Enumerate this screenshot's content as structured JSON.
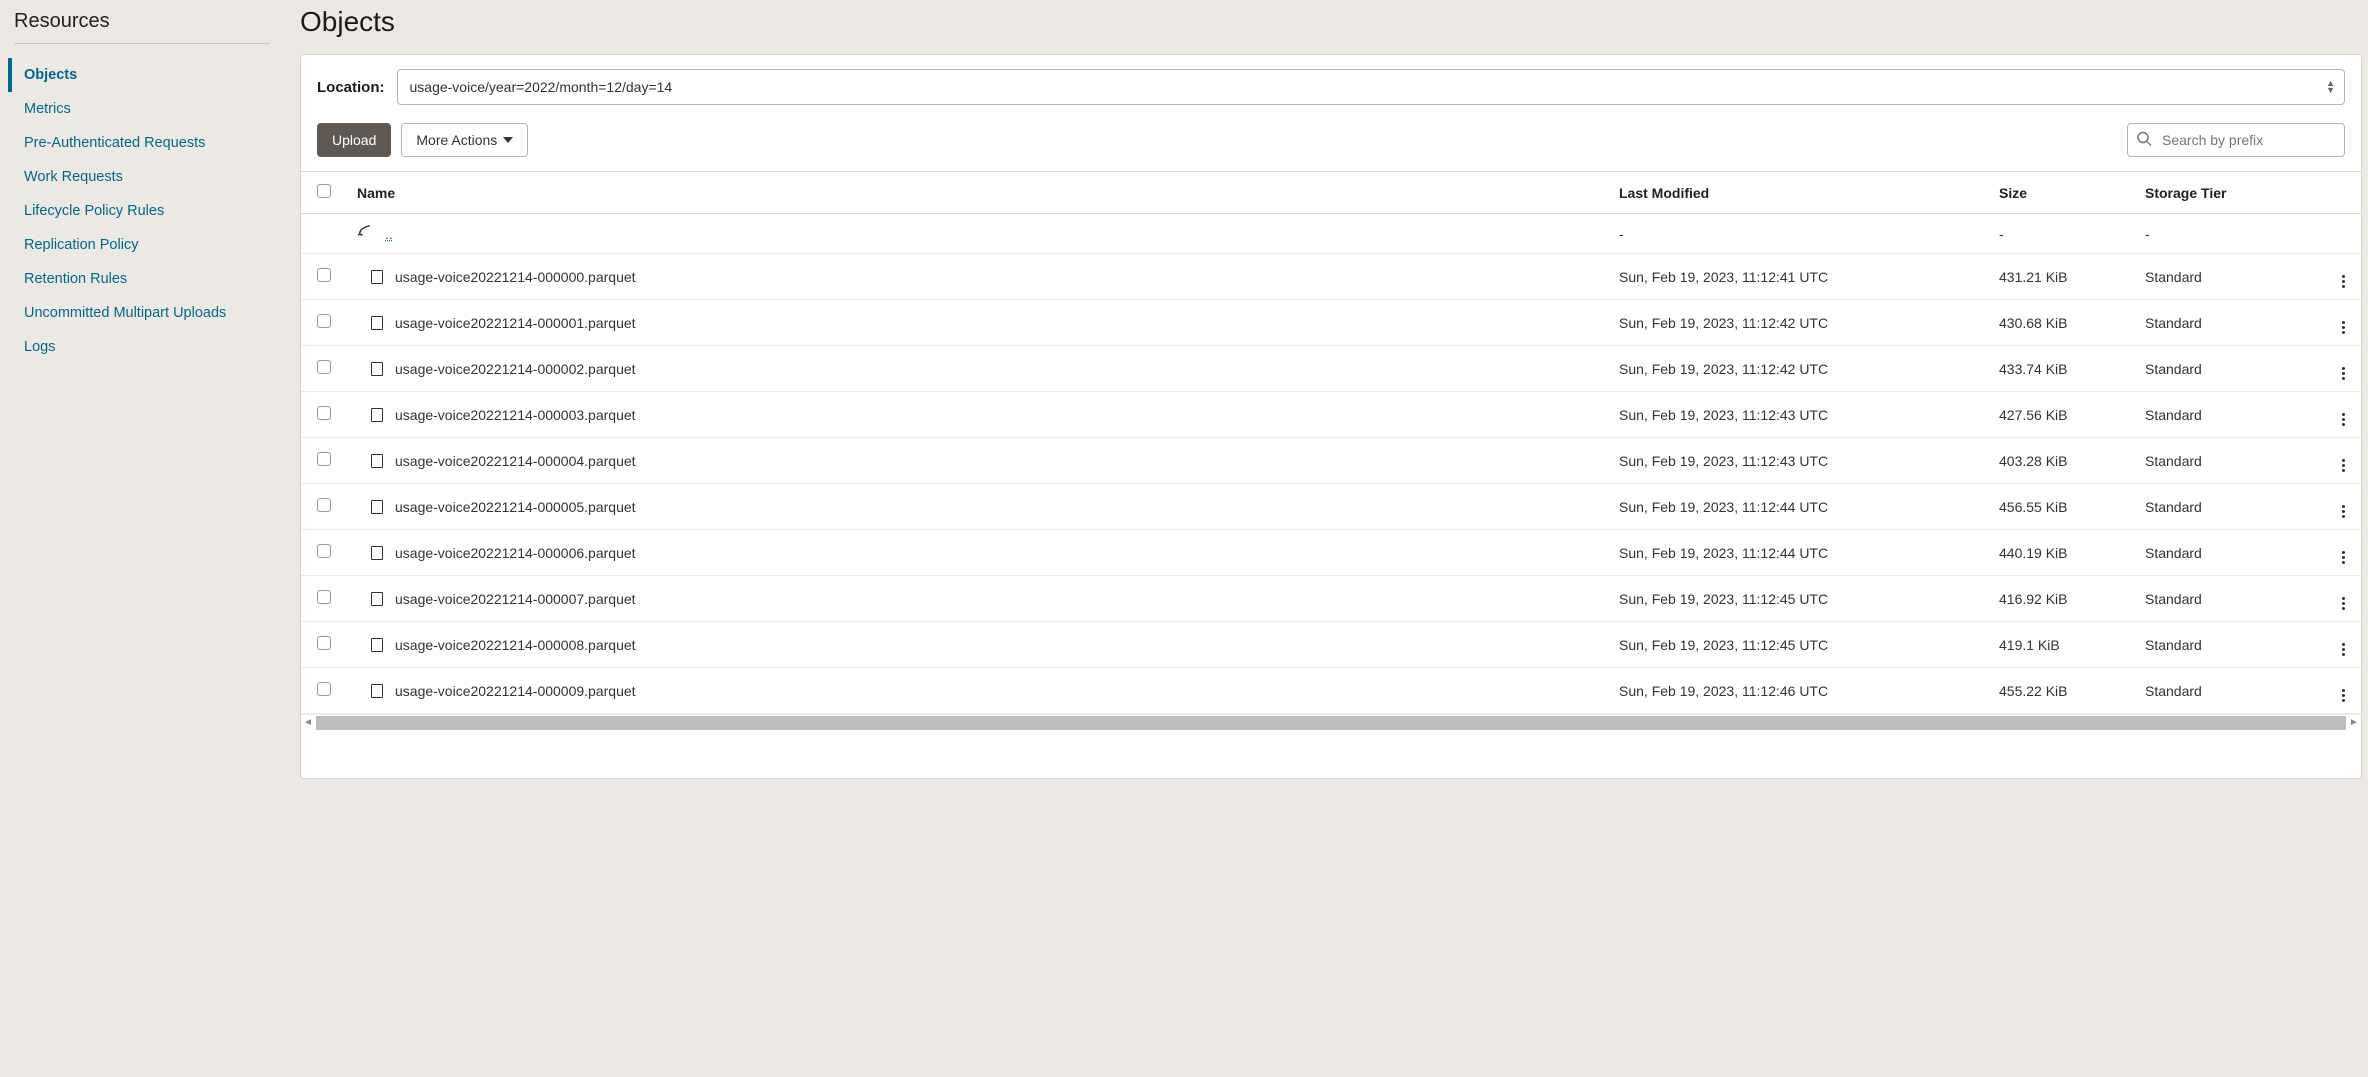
{
  "sidebar": {
    "title": "Resources",
    "items": [
      {
        "label": "Objects",
        "active": true
      },
      {
        "label": "Metrics"
      },
      {
        "label": "Pre-Authenticated Requests"
      },
      {
        "label": "Work Requests"
      },
      {
        "label": "Lifecycle Policy Rules"
      },
      {
        "label": "Replication Policy"
      },
      {
        "label": "Retention Rules"
      },
      {
        "label": "Uncommitted Multipart Uploads"
      },
      {
        "label": "Logs"
      }
    ]
  },
  "header": {
    "title": "Objects"
  },
  "location": {
    "label": "Location:",
    "value": "usage-voice/year=2022/month=12/day=14"
  },
  "toolbar": {
    "upload_label": "Upload",
    "more_actions_label": "More Actions"
  },
  "search": {
    "placeholder": "Search by prefix"
  },
  "table": {
    "columns": {
      "name": "Name",
      "last_modified": "Last Modified",
      "size": "Size",
      "storage_tier": "Storage Tier"
    },
    "parent_row": {
      "dots": "..",
      "last_modified": "-",
      "size": "-",
      "tier": "-"
    },
    "rows": [
      {
        "name": "usage-voice20221214-000000.parquet",
        "last_modified": "Sun, Feb 19, 2023, 11:12:41 UTC",
        "size": "431.21 KiB",
        "tier": "Standard"
      },
      {
        "name": "usage-voice20221214-000001.parquet",
        "last_modified": "Sun, Feb 19, 2023, 11:12:42 UTC",
        "size": "430.68 KiB",
        "tier": "Standard"
      },
      {
        "name": "usage-voice20221214-000002.parquet",
        "last_modified": "Sun, Feb 19, 2023, 11:12:42 UTC",
        "size": "433.74 KiB",
        "tier": "Standard"
      },
      {
        "name": "usage-voice20221214-000003.parquet",
        "last_modified": "Sun, Feb 19, 2023, 11:12:43 UTC",
        "size": "427.56 KiB",
        "tier": "Standard"
      },
      {
        "name": "usage-voice20221214-000004.parquet",
        "last_modified": "Sun, Feb 19, 2023, 11:12:43 UTC",
        "size": "403.28 KiB",
        "tier": "Standard"
      },
      {
        "name": "usage-voice20221214-000005.parquet",
        "last_modified": "Sun, Feb 19, 2023, 11:12:44 UTC",
        "size": "456.55 KiB",
        "tier": "Standard"
      },
      {
        "name": "usage-voice20221214-000006.parquet",
        "last_modified": "Sun, Feb 19, 2023, 11:12:44 UTC",
        "size": "440.19 KiB",
        "tier": "Standard"
      },
      {
        "name": "usage-voice20221214-000007.parquet",
        "last_modified": "Sun, Feb 19, 2023, 11:12:45 UTC",
        "size": "416.92 KiB",
        "tier": "Standard"
      },
      {
        "name": "usage-voice20221214-000008.parquet",
        "last_modified": "Sun, Feb 19, 2023, 11:12:45 UTC",
        "size": "419.1 KiB",
        "tier": "Standard"
      },
      {
        "name": "usage-voice20221214-000009.parquet",
        "last_modified": "Sun, Feb 19, 2023, 11:12:46 UTC",
        "size": "455.22 KiB",
        "tier": "Standard"
      }
    ]
  }
}
